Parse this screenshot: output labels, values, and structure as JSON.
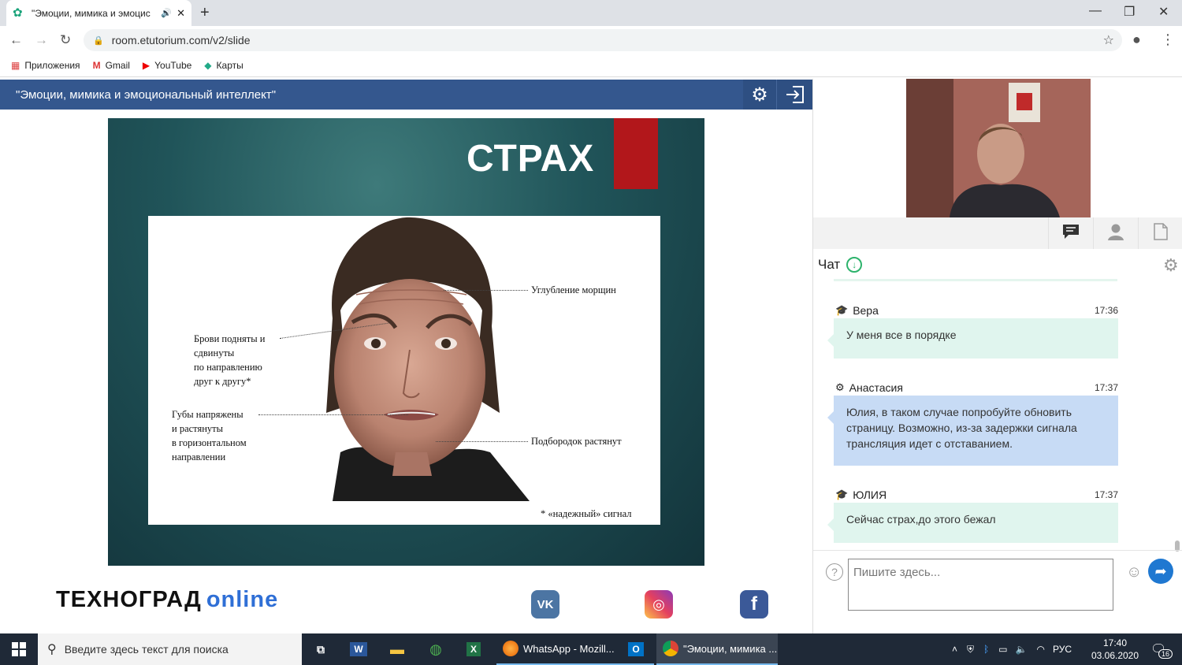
{
  "browser": {
    "tab_title": "\"Эмоции, мимика и эмоциональный интеллект\"",
    "tab_title_visible": "\"Эмоции, мимика и эмоцис",
    "url": "room.etutorium.com/v2/slide",
    "bookmarks": [
      {
        "label": "Приложения",
        "icon": "apps-grid-icon"
      },
      {
        "label": "Gmail",
        "icon": "gmail-icon"
      },
      {
        "label": "YouTube",
        "icon": "youtube-icon"
      },
      {
        "label": "Карты",
        "icon": "maps-icon"
      }
    ]
  },
  "app": {
    "header_title": "\"Эмоции, мимика и эмоциональный интеллект\"",
    "accent": "#34578e"
  },
  "slide": {
    "heading": "СТРАХ",
    "annotations": {
      "wrinkles": "Углубление морщин",
      "brows": "Брови подняты и\nсдвинуты\nпо направлению\nдруг к другу*",
      "lips": "Губы напряжены\nи растянуты\nв горизонтальном\nнаправлении",
      "chin": "Подбородок растянут",
      "footnote": "* «надежный» сигнал"
    }
  },
  "footer": {
    "logo_main": "ТЕХНОГРАД",
    "logo_suffix": "online",
    "social": [
      {
        "name": "vk",
        "glyph": "VK",
        "color": "#4c75a3"
      },
      {
        "name": "instagram",
        "glyph": "◎",
        "color": "#d6249f"
      },
      {
        "name": "facebook",
        "glyph": "f",
        "color": "#3b5998"
      }
    ]
  },
  "chat": {
    "title": "Чат",
    "input_placeholder": "Пишите здесь...",
    "messages": [
      {
        "author": "Вера",
        "time": "17:36",
        "role": "student",
        "text": "У меня все в порядке",
        "color": "#e0f5ee"
      },
      {
        "author": "Анастасия",
        "time": "17:37",
        "role": "moderator",
        "text": "Юлия, в таком случае попробуйте обновить страницу. Возможно, из-за задержки сигнала трансляция идет с отставанием.",
        "color": "#c7dbf5"
      },
      {
        "author": "ЮЛИЯ",
        "time": "17:37",
        "role": "student",
        "text": "Сейчас страх,до этого бежал",
        "color": "#e0f5ee"
      }
    ]
  },
  "taskbar": {
    "search_placeholder": "Введите здесь текст для поиска",
    "apps": [
      {
        "label": "WhatsApp - Mozill...",
        "icon": "firefox-icon"
      },
      {
        "label": "\"Эмоции, мимика ...",
        "icon": "chrome-icon"
      }
    ],
    "lang": "РУС",
    "time": "17:40",
    "date": "03.06.2020",
    "notifications": "16"
  }
}
